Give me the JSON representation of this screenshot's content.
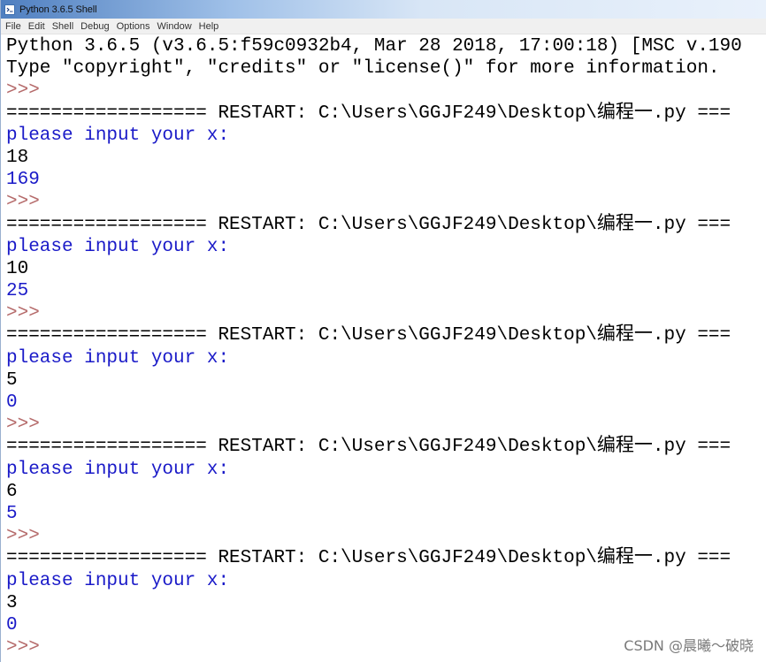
{
  "window": {
    "title": "Python 3.6.5 Shell",
    "icon": "python-shell-icon"
  },
  "menu": [
    "File",
    "Edit",
    "Shell",
    "Debug",
    "Options",
    "Window",
    "Help"
  ],
  "shell_lines": [
    {
      "text": "Python 3.6.5 (v3.6.5:f59c0932b4, Mar 28 2018, 17:00:18) [MSC v.190",
      "kind": "stdout"
    },
    {
      "text": "Type \"copyright\", \"credits\" or \"license()\" for more information.",
      "kind": "stdout"
    },
    {
      "text": ">>>",
      "kind": "prompt"
    },
    {
      "text": "================== RESTART: C:\\Users\\GGJF249\\Desktop\\编程一.py ===",
      "kind": "stdout"
    },
    {
      "text": "please input your x:",
      "kind": "output"
    },
    {
      "text": "18",
      "kind": "stdout"
    },
    {
      "text": "169",
      "kind": "output"
    },
    {
      "text": ">>>",
      "kind": "prompt"
    },
    {
      "text": "================== RESTART: C:\\Users\\GGJF249\\Desktop\\编程一.py ===",
      "kind": "stdout"
    },
    {
      "text": "please input your x:",
      "kind": "output"
    },
    {
      "text": "10",
      "kind": "stdout"
    },
    {
      "text": "25",
      "kind": "output"
    },
    {
      "text": ">>>",
      "kind": "prompt"
    },
    {
      "text": "================== RESTART: C:\\Users\\GGJF249\\Desktop\\编程一.py ===",
      "kind": "stdout"
    },
    {
      "text": "please input your x:",
      "kind": "output"
    },
    {
      "text": "5",
      "kind": "stdout"
    },
    {
      "text": "0",
      "kind": "output"
    },
    {
      "text": ">>>",
      "kind": "prompt"
    },
    {
      "text": "================== RESTART: C:\\Users\\GGJF249\\Desktop\\编程一.py ===",
      "kind": "stdout"
    },
    {
      "text": "please input your x:",
      "kind": "output"
    },
    {
      "text": "6",
      "kind": "stdout"
    },
    {
      "text": "5",
      "kind": "output"
    },
    {
      "text": ">>>",
      "kind": "prompt"
    },
    {
      "text": "================== RESTART: C:\\Users\\GGJF249\\Desktop\\编程一.py ===",
      "kind": "stdout"
    },
    {
      "text": "please input your x:",
      "kind": "output"
    },
    {
      "text": "3",
      "kind": "stdout"
    },
    {
      "text": "0",
      "kind": "output"
    },
    {
      "text": ">>>",
      "kind": "prompt"
    }
  ],
  "colors": {
    "stdout": "#000000",
    "output": "#1a1ac8",
    "prompt": "#b56a6a"
  },
  "watermark": "CSDN @晨曦～破晓"
}
